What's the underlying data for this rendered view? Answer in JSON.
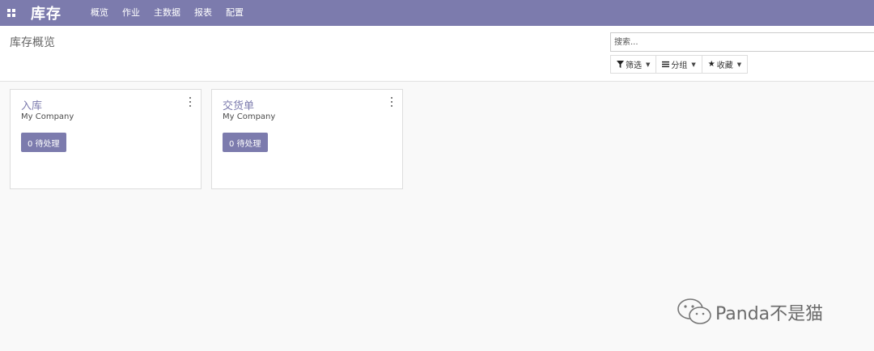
{
  "navbar": {
    "app_title": "库存",
    "menu": [
      "概览",
      "作业",
      "主数据",
      "报表",
      "配置"
    ]
  },
  "control_panel": {
    "title": "库存概览",
    "search_placeholder": "搜索...",
    "filters": {
      "filter_label": "筛选",
      "group_label": "分组",
      "favorites_label": "收藏"
    }
  },
  "cards": [
    {
      "title": "入库",
      "company": "My Company",
      "button": "0 待处理"
    },
    {
      "title": "交货单",
      "company": "My Company",
      "button": "0 待处理"
    }
  ],
  "watermark": {
    "text": "Panda不是猫"
  },
  "colors": {
    "primary": "#7c7bad",
    "background": "#f9f9f9"
  }
}
